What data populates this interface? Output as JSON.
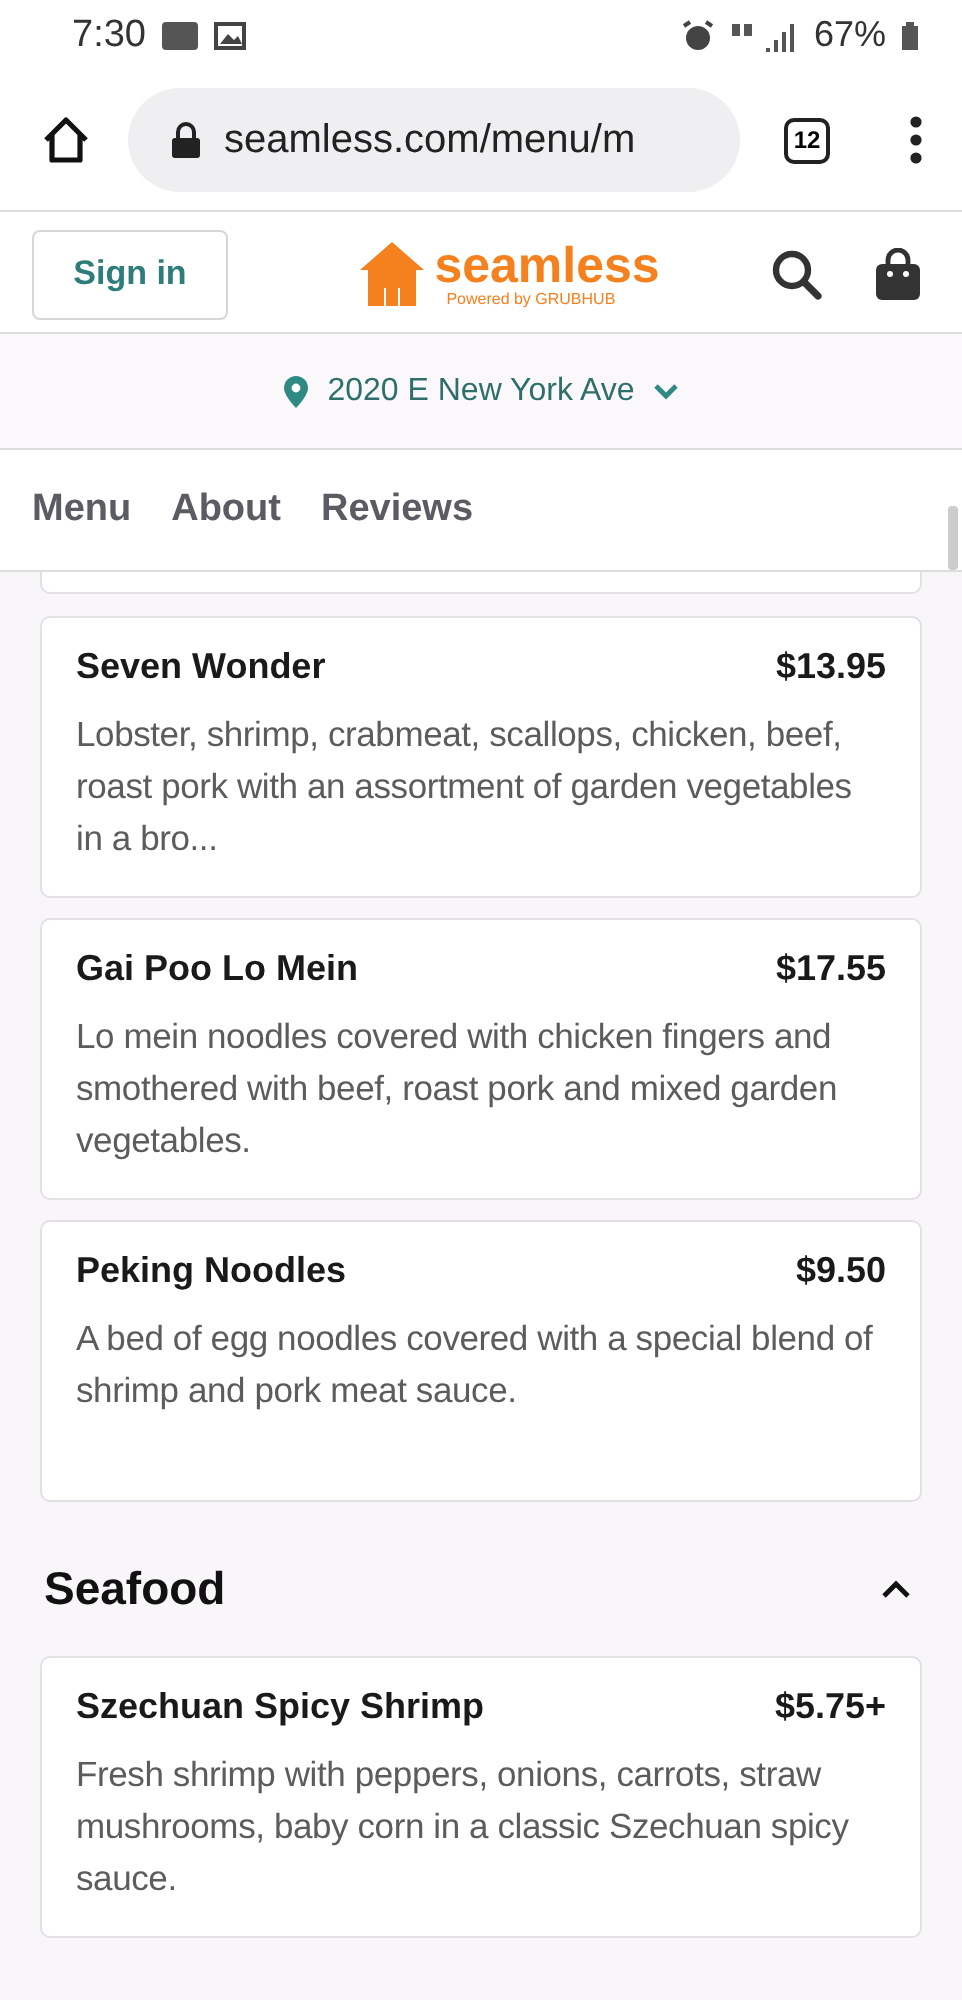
{
  "status_bar": {
    "time": "7:30",
    "battery": "67%"
  },
  "browser": {
    "url": "seamless.com/menu/m",
    "tab_count": "12"
  },
  "header": {
    "sign_in": "Sign in",
    "logo_name": "seamless",
    "logo_tagline": "Powered by GRUBHUB"
  },
  "location": {
    "address": "2020 E New York Ave"
  },
  "tabs": [
    {
      "label": "Menu"
    },
    {
      "label": "About"
    },
    {
      "label": "Reviews"
    }
  ],
  "sections": [
    {
      "items": [
        {
          "name": "Seven Wonder",
          "price": "$13.95",
          "description": "Lobster, shrimp, crabmeat, scallops, chicken, beef, roast pork with an assortment of garden vegetables in a bro..."
        },
        {
          "name": "Gai Poo Lo Mein",
          "price": "$17.55",
          "description": "Lo mein noodles covered with chicken fingers and smothered with beef, roast pork and mixed garden vegetables."
        },
        {
          "name": "Peking Noodles",
          "price": "$9.50",
          "description": "A bed of egg noodles covered with a special blend of shrimp and pork meat sauce."
        }
      ]
    },
    {
      "title": "Seafood",
      "expanded": true,
      "items": [
        {
          "name": "Szechuan Spicy Shrimp",
          "price": "$5.75+",
          "description": "Fresh shrimp with peppers, onions, carrots, straw mushrooms, baby corn in a classic Szechuan spicy sauce."
        }
      ]
    }
  ]
}
